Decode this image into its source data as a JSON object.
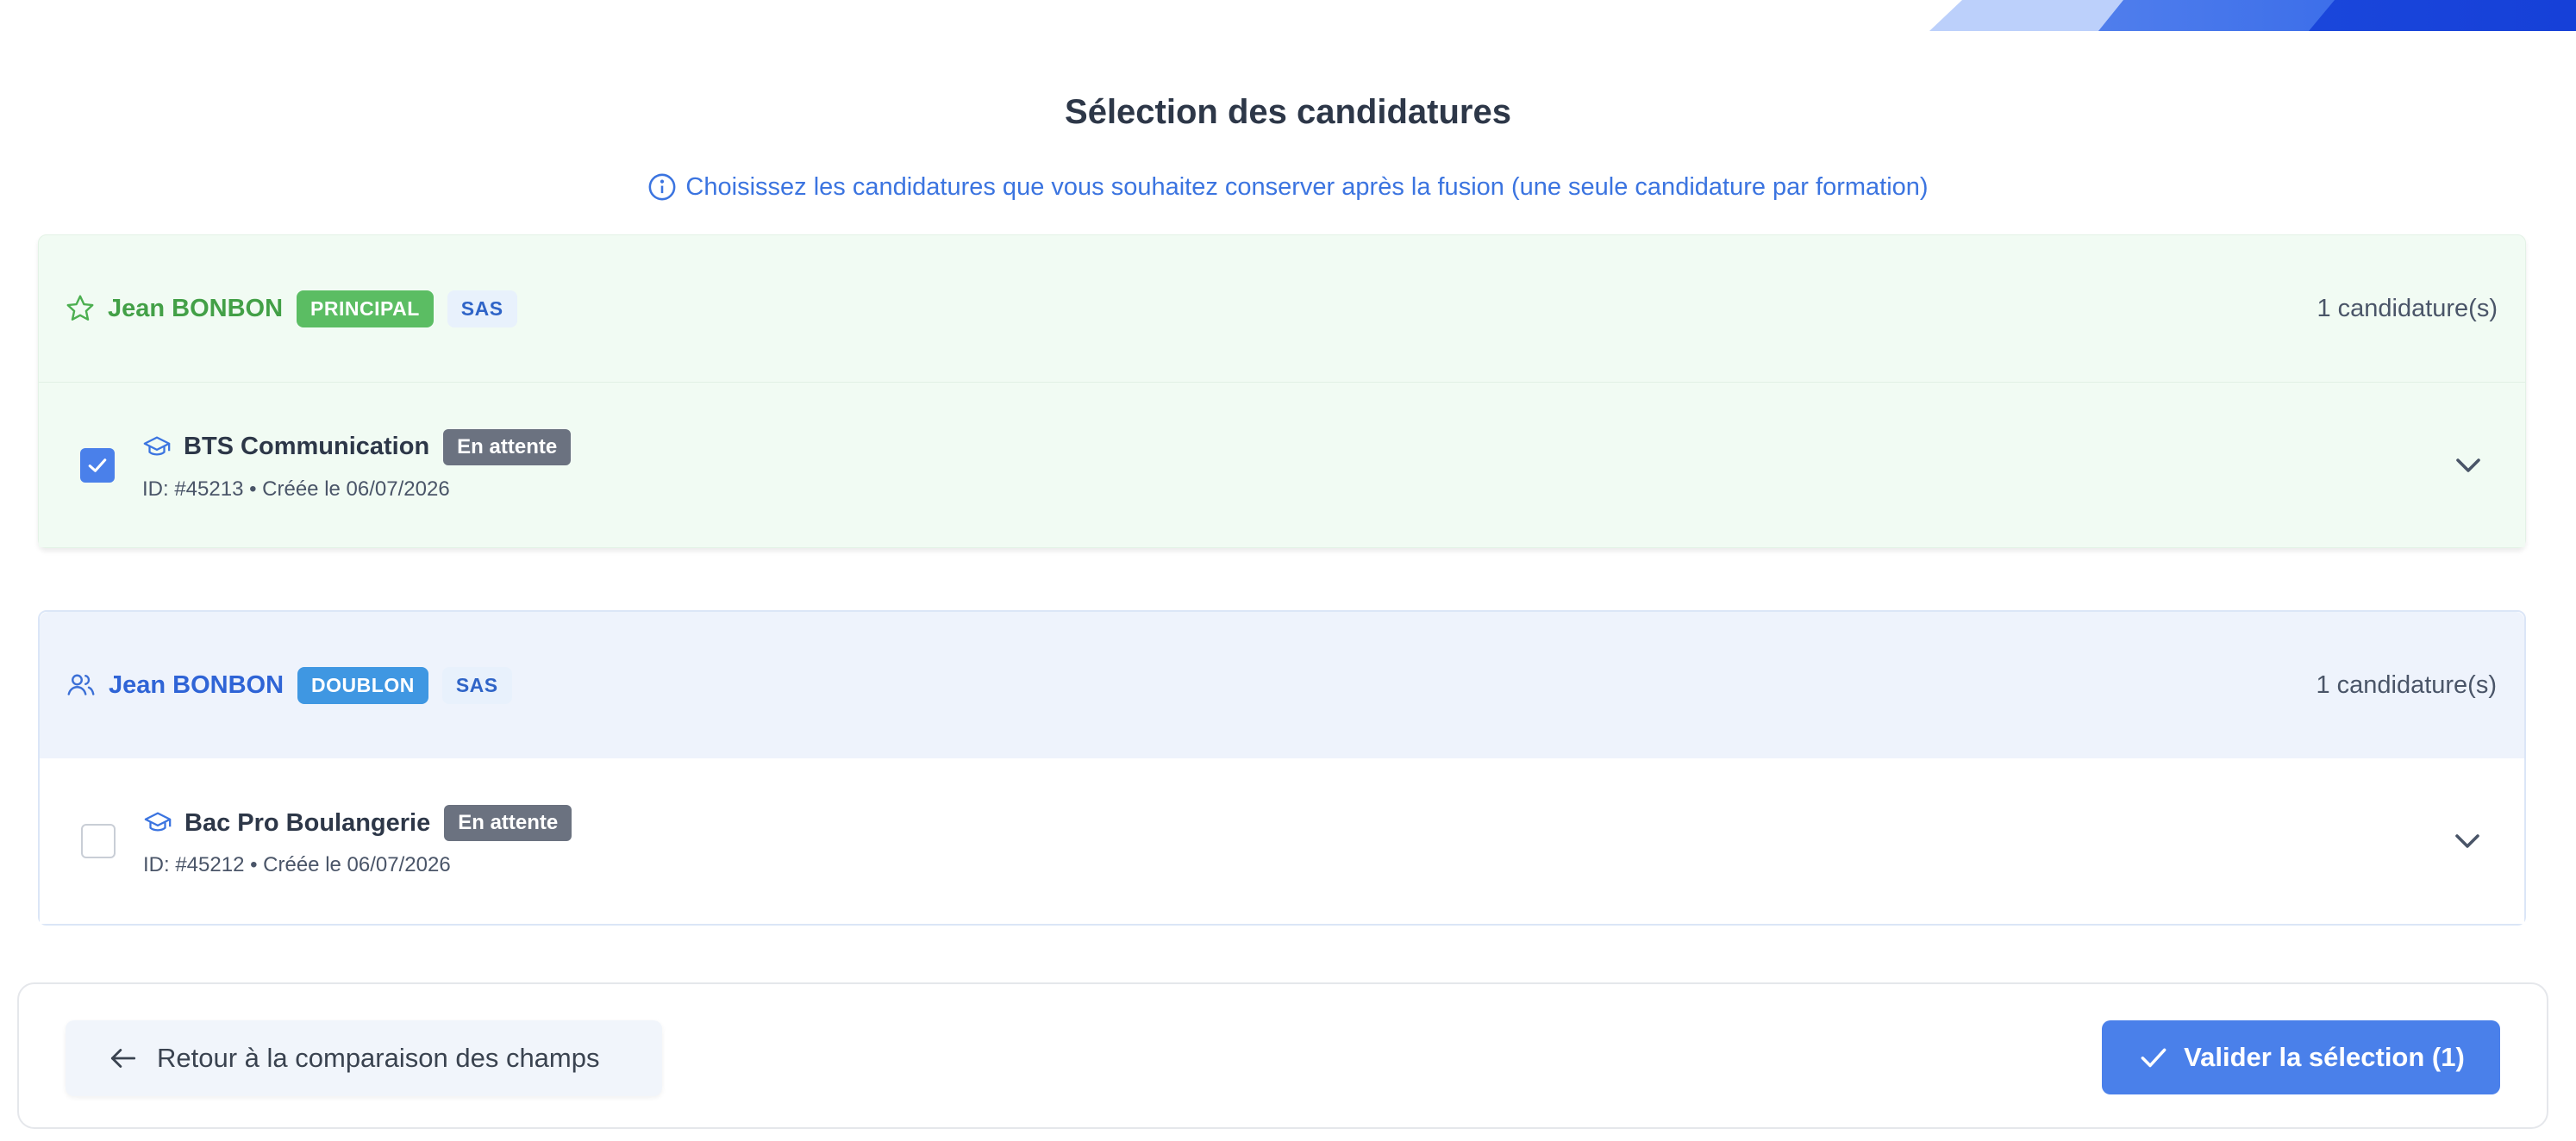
{
  "page": {
    "title": "Sélection des candidatures",
    "hint": "Choisissez les candidatures que vous souhaitez conserver après la fusion (une seule candidature par formation)"
  },
  "colors": {
    "accent": "#4a80ea",
    "principal_green": "#4caf50",
    "doublon_blue": "#3f97e2",
    "status_gray": "#6b7280",
    "principal_bg": "#f1fbf3",
    "doublon_bg": "#eef3fc"
  },
  "groups": [
    {
      "name": "Jean BONBON",
      "icon": "star-icon",
      "role_badge": "PRINCIPAL",
      "source_badge": "SAS",
      "count": "1 candidature(s)",
      "applications": [
        {
          "course": "BTS Communication",
          "status": "En attente",
          "meta": "ID: #45213 • Créée le 06/07/2026",
          "checked": true
        }
      ]
    },
    {
      "name": "Jean BONBON",
      "icon": "users-icon",
      "role_badge": "DOUBLON",
      "source_badge": "SAS",
      "count": "1 candidature(s)",
      "applications": [
        {
          "course": "Bac Pro Boulangerie",
          "status": "En attente",
          "meta": "ID: #45212 • Créée le 06/07/2026",
          "checked": false
        }
      ]
    }
  ],
  "footer": {
    "back_label": "Retour à la comparaison des champs",
    "validate_label": "Valider la sélection (1)"
  }
}
